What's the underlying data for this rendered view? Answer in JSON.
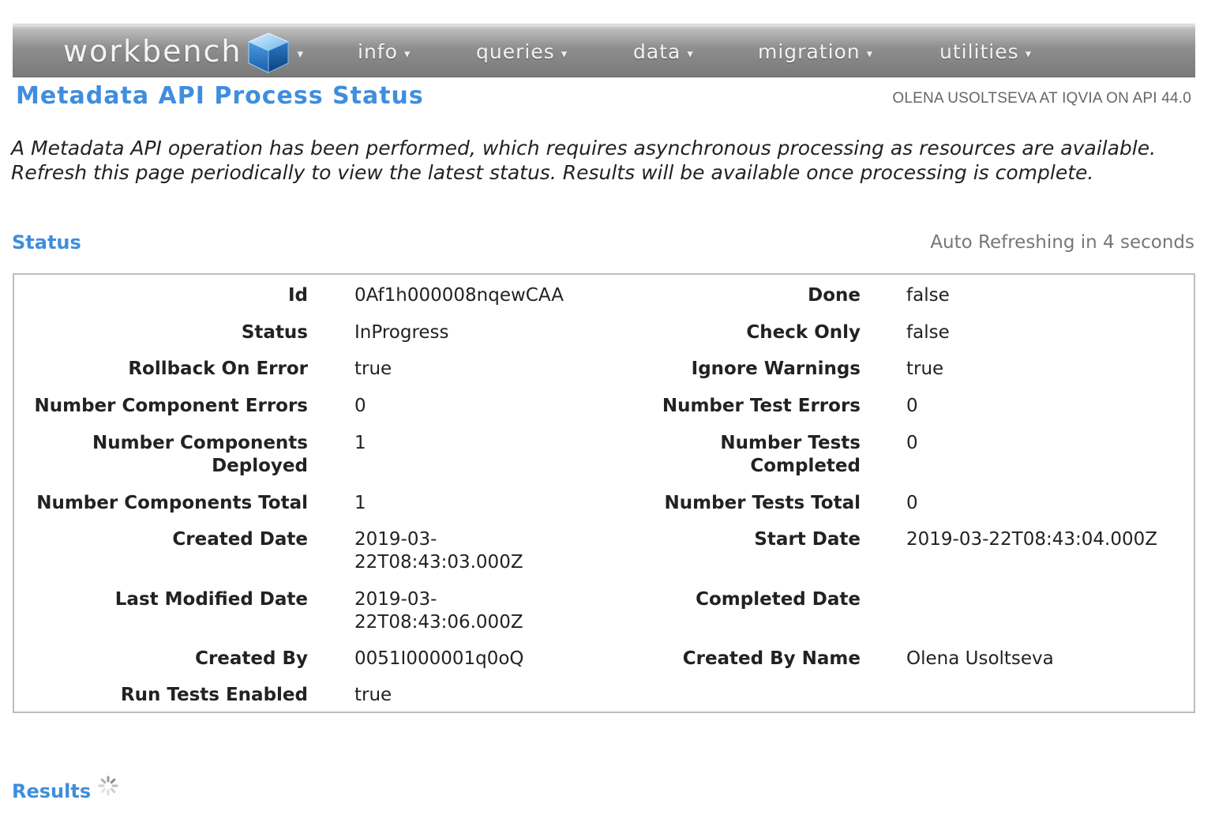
{
  "nav": {
    "brand": "workbench",
    "items": [
      "info",
      "queries",
      "data",
      "migration",
      "utilities"
    ]
  },
  "header": {
    "title": "Metadata API Process Status",
    "user_info": "OLENA USOLTSEVA AT IQVIA ON API 44.0"
  },
  "intro": "A Metadata API operation has been performed, which requires asynchronous processing as resources are available. Refresh this page periodically to view the latest status. Results will be available once processing is complete.",
  "status_section": {
    "title": "Status",
    "refresh_note": "Auto Refreshing in 4 seconds",
    "rows": [
      {
        "left_label": "Id",
        "left_value": "0Af1h000008nqewCAA",
        "right_label": "Done",
        "right_value": "false"
      },
      {
        "left_label": "Status",
        "left_value": "InProgress",
        "right_label": "Check Only",
        "right_value": "false"
      },
      {
        "left_label": "Rollback On Error",
        "left_value": "true",
        "right_label": "Ignore Warnings",
        "right_value": "true"
      },
      {
        "left_label": "Number Component Errors",
        "left_value": "0",
        "right_label": "Number Test Errors",
        "right_value": "0"
      },
      {
        "left_label": "Number Components Deployed",
        "left_value": "1",
        "right_label": "Number Tests Completed",
        "right_value": "0"
      },
      {
        "left_label": "Number Components Total",
        "left_value": "1",
        "right_label": "Number Tests Total",
        "right_value": "0"
      },
      {
        "left_label": "Created Date",
        "left_value": "2019-03-22T08:43:03.000Z",
        "right_label": "Start Date",
        "right_value": "2019-03-22T08:43:04.000Z"
      },
      {
        "left_label": "Last Modified Date",
        "left_value": "2019-03-22T08:43:06.000Z",
        "right_label": "Completed Date",
        "right_value": ""
      },
      {
        "left_label": "Created By",
        "left_value": "0051I000001q0oQ",
        "right_label": "Created By Name",
        "right_value": "Olena Usoltseva"
      },
      {
        "left_label": "Run Tests Enabled",
        "left_value": "true",
        "right_label": "",
        "right_value": ""
      }
    ]
  },
  "results_section": {
    "title": "Results",
    "loading_icon": "spinner-icon"
  }
}
